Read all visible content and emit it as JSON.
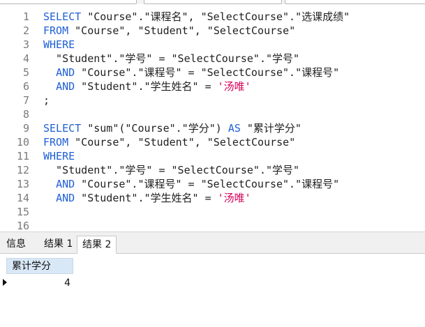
{
  "editor": {
    "lines": [
      {
        "n": "1",
        "tokens": [
          {
            "t": "SELECT",
            "c": "kw"
          },
          {
            "t": " \"Course\".\"课程名\", \"SelectCourse\".\"选课成绩\"",
            "c": "plain"
          }
        ]
      },
      {
        "n": "2",
        "tokens": [
          {
            "t": "FROM",
            "c": "kw"
          },
          {
            "t": " \"Course\", \"Student\", \"SelectCourse\"",
            "c": "plain"
          }
        ]
      },
      {
        "n": "3",
        "tokens": [
          {
            "t": "WHERE",
            "c": "kw"
          }
        ]
      },
      {
        "n": "4",
        "tokens": [
          {
            "t": "  \"Student\".\"学号\" = \"SelectCourse\".\"学号\"",
            "c": "plain"
          }
        ]
      },
      {
        "n": "5",
        "tokens": [
          {
            "t": "  ",
            "c": "plain"
          },
          {
            "t": "AND",
            "c": "kw"
          },
          {
            "t": " \"Course\".\"课程号\" = \"SelectCourse\".\"课程号\"",
            "c": "plain"
          }
        ]
      },
      {
        "n": "6",
        "tokens": [
          {
            "t": "  ",
            "c": "plain"
          },
          {
            "t": "AND",
            "c": "kw"
          },
          {
            "t": " \"Student\".\"学生姓名\" = ",
            "c": "plain"
          },
          {
            "t": "'汤唯'",
            "c": "str"
          }
        ]
      },
      {
        "n": "7",
        "tokens": [
          {
            "t": ";",
            "c": "plain"
          }
        ]
      },
      {
        "n": "8",
        "tokens": []
      },
      {
        "n": "9",
        "tokens": [
          {
            "t": "SELECT",
            "c": "kw"
          },
          {
            "t": " \"sum\"(\"Course\".\"学分\") ",
            "c": "plain"
          },
          {
            "t": "AS",
            "c": "kw"
          },
          {
            "t": " \"累计学分\"",
            "c": "plain"
          }
        ]
      },
      {
        "n": "10",
        "tokens": [
          {
            "t": "FROM",
            "c": "kw"
          },
          {
            "t": " \"Course\", \"Student\", \"SelectCourse\"",
            "c": "plain"
          }
        ]
      },
      {
        "n": "11",
        "tokens": [
          {
            "t": "WHERE",
            "c": "kw"
          }
        ]
      },
      {
        "n": "12",
        "tokens": [
          {
            "t": "  \"Student\".\"学号\" = \"SelectCourse\".\"学号\"",
            "c": "plain"
          }
        ]
      },
      {
        "n": "13",
        "tokens": [
          {
            "t": "  ",
            "c": "plain"
          },
          {
            "t": "AND",
            "c": "kw"
          },
          {
            "t": " \"Course\".\"课程号\" = \"SelectCourse\".\"课程号\"",
            "c": "plain"
          }
        ]
      },
      {
        "n": "14",
        "tokens": [
          {
            "t": "  ",
            "c": "plain"
          },
          {
            "t": "AND",
            "c": "kw"
          },
          {
            "t": " \"Student\".\"学生姓名\" = ",
            "c": "plain"
          },
          {
            "t": "'汤唯'",
            "c": "str"
          }
        ]
      },
      {
        "n": "15",
        "tokens": []
      },
      {
        "n": "16",
        "tokens": []
      }
    ]
  },
  "tabs": {
    "info_label": "信息",
    "result1_label": "结果 1",
    "result2_label": "结果 2"
  },
  "results": {
    "columns": [
      "累计学分"
    ],
    "rows": [
      [
        "4"
      ]
    ]
  },
  "colors": {
    "keyword": "#1f5fd6",
    "string": "#d4005a",
    "header_bg": "#d9e8f7"
  }
}
